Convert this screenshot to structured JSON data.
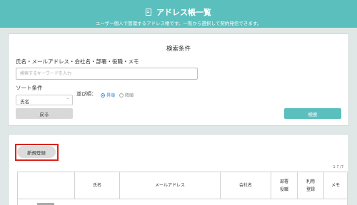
{
  "header": {
    "title": "アドレス帳一覧",
    "subtitle": "ユーザー個人で管理するアドレス帳です。一覧から選択して契約発信できます。",
    "icon": "address-book-icon",
    "bg_color": "#5bbfbd"
  },
  "search": {
    "title": "検索条件",
    "keyword_label": "氏名・メールアドレス・会社名・部署・役職・メモ",
    "keyword_placeholder": "検索するキーワードを入力",
    "keyword_value": "",
    "sort_label": "ソート条件",
    "sort_selected": "氏名",
    "order_label": "並び順：",
    "order_asc": "昇順",
    "order_desc": "降順",
    "order_selected": "asc",
    "back_label": "戻る",
    "search_label": "検索"
  },
  "list": {
    "new_button": "新規登録",
    "pager": "1-7 /7",
    "columns": [
      "",
      "氏名",
      "メールアドレス",
      "会社名",
      "部署\n役職",
      "利用\n登録",
      "メモ"
    ],
    "highlight_color": "#d8231c"
  }
}
